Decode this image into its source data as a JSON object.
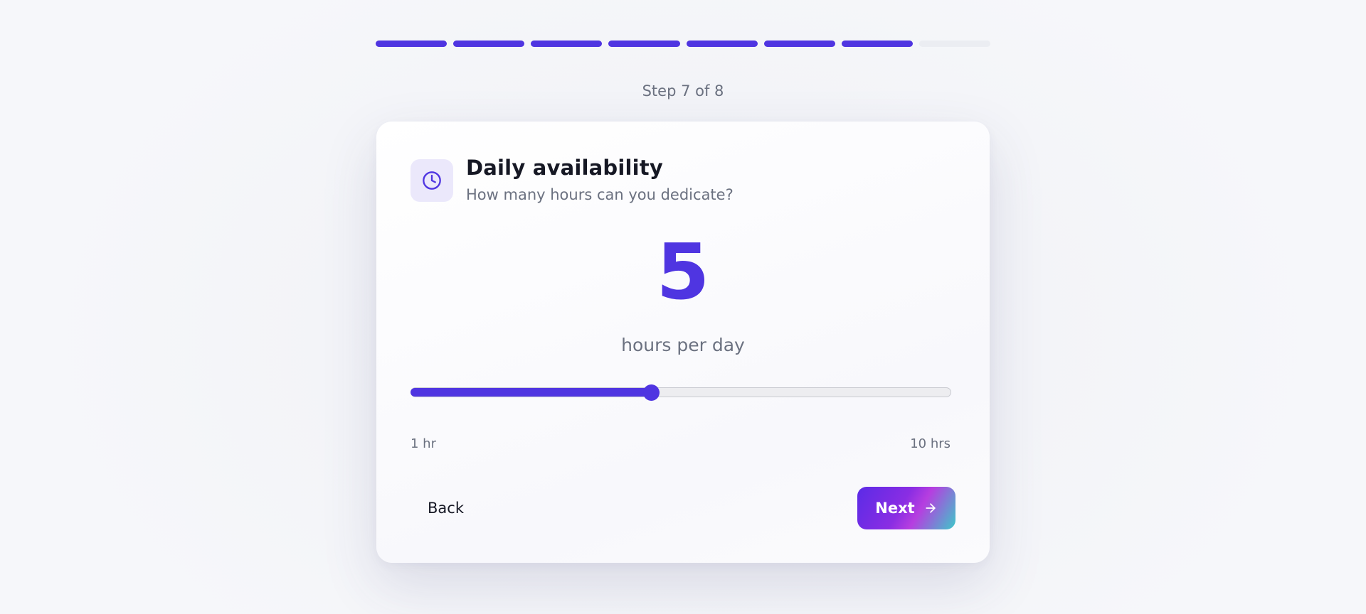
{
  "progress": {
    "total_steps": 8,
    "completed_steps": 7,
    "active_color": "#4f35e1",
    "inactive_color": "#ebedf2",
    "label": "Step 7 of 8"
  },
  "card": {
    "icon": "clock-icon",
    "title": "Daily availability",
    "subtitle": "How many hours can you dedicate?",
    "value": "5",
    "unit_label": "hours per day"
  },
  "slider": {
    "min": 1,
    "max": 10,
    "value": 5,
    "min_label": "1 hr",
    "max_label": "10 hrs"
  },
  "actions": {
    "back_label": "Back",
    "next_label": "Next",
    "next_icon": "arrow-right-icon"
  },
  "colors": {
    "accent": "#4f35e1"
  }
}
